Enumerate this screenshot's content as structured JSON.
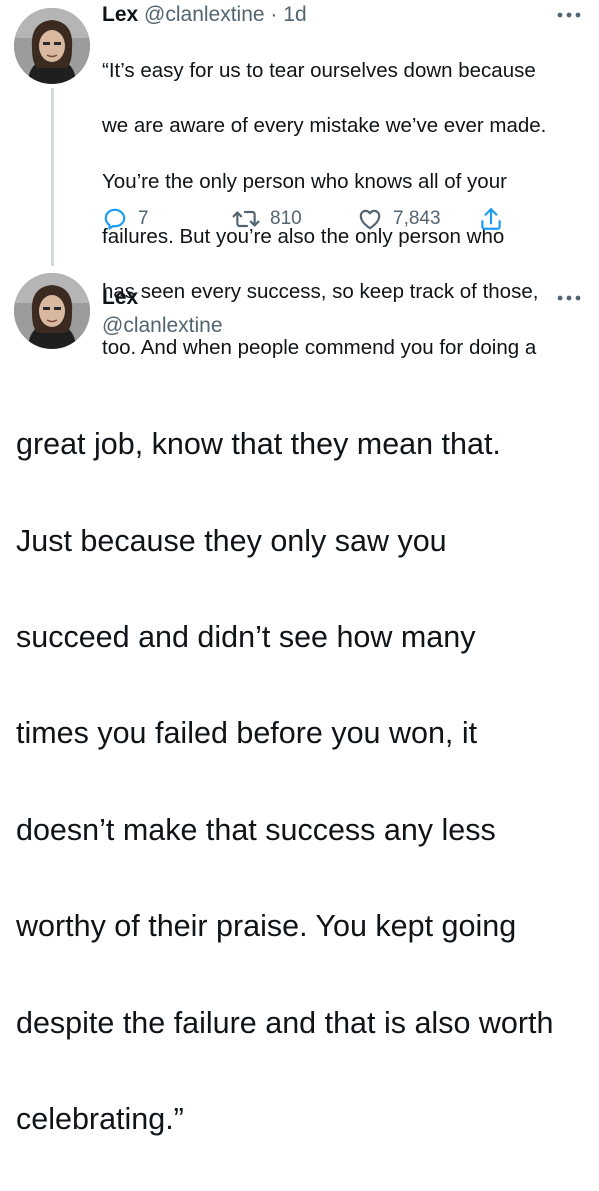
{
  "tweet1": {
    "author_name": "Lex",
    "handle": "@clanlextine",
    "separator": "·",
    "time": "1d",
    "body_lines": [
      "“It’s easy for us to tear ourselves down because",
      "we are aware of every mistake we’ve ever made.",
      "You’re the only person who knows all of your",
      "failures. But you’re also the only person who",
      "has seen every success, so keep track of those,",
      "too. And when people commend you for doing a"
    ],
    "replies": "7",
    "retweets": "810",
    "likes": "7,843"
  },
  "tweet2": {
    "author_name": "Lex",
    "handle": "@clanlextine",
    "body_lines": [
      "great job, know that they mean that.",
      "Just because they only saw you",
      "succeed and didn’t see how many",
      "times you failed before you won, it",
      "doesn’t make that success any less",
      "worthy of their praise. You kept going",
      "despite the failure and that is also worth",
      "celebrating.”"
    ]
  },
  "colors": {
    "text": "#0f1419",
    "muted": "#536471",
    "thread_line": "#cfd9de"
  },
  "icons": {
    "more": "more-horizontal-icon",
    "reply": "reply-icon",
    "retweet": "retweet-icon",
    "like": "heart-icon",
    "share": "share-icon"
  }
}
